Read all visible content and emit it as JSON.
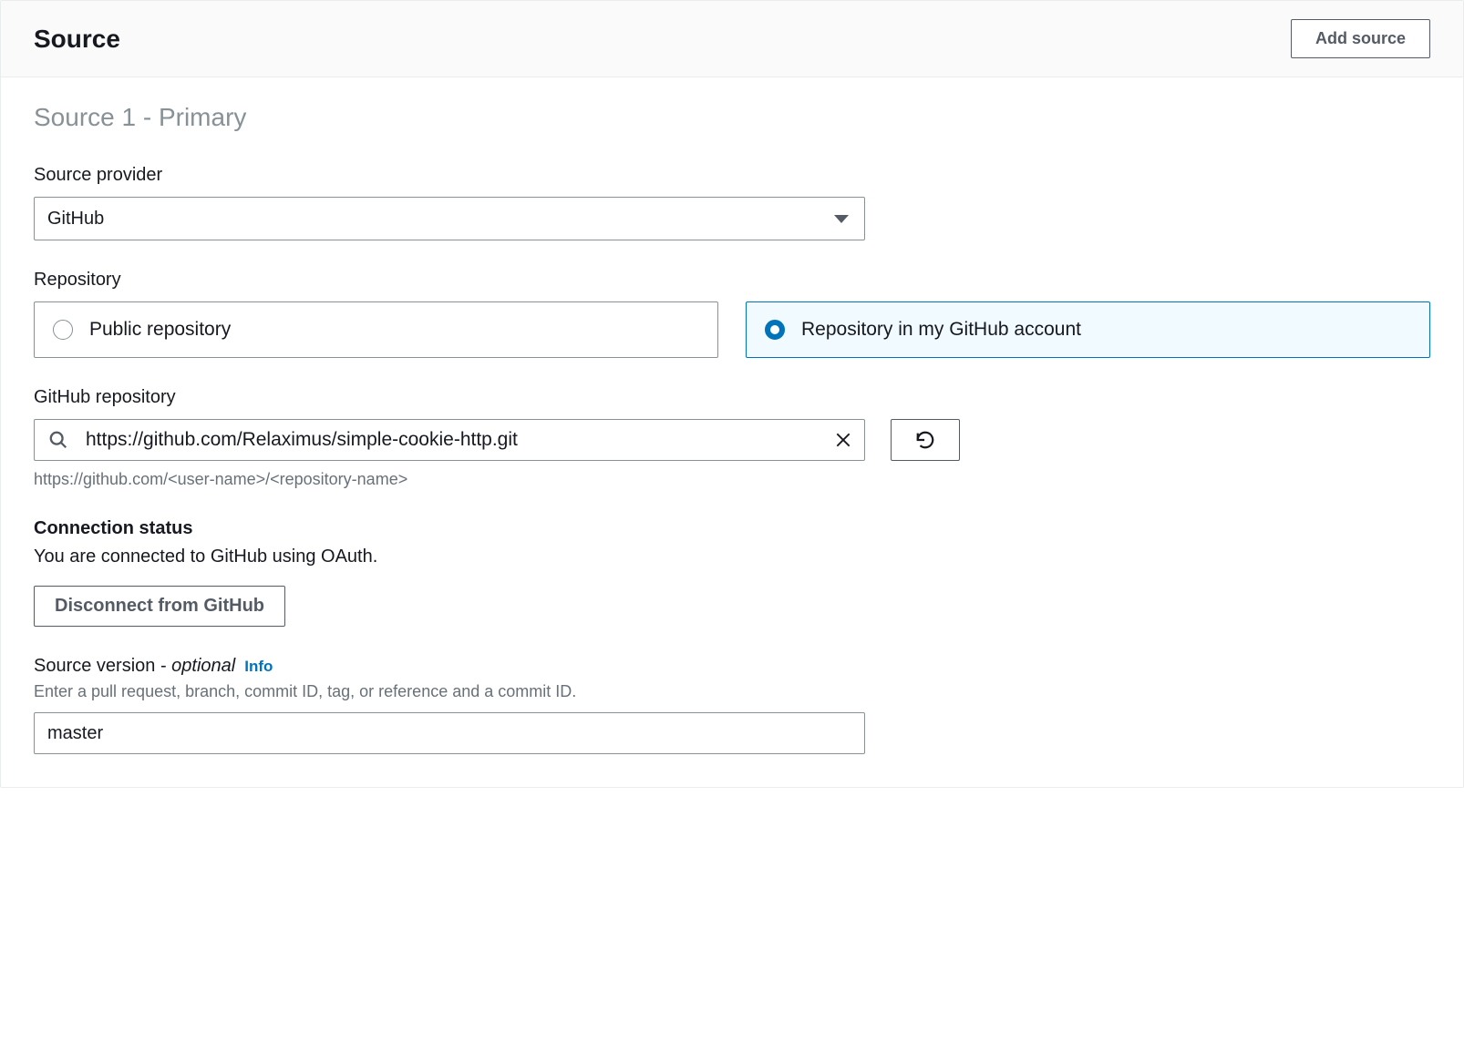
{
  "header": {
    "title": "Source",
    "add_button": "Add source"
  },
  "section": {
    "subheading": "Source 1 - Primary"
  },
  "sourceProvider": {
    "label": "Source provider",
    "value": "GitHub"
  },
  "repository": {
    "label": "Repository",
    "options": [
      {
        "label": "Public repository",
        "selected": false
      },
      {
        "label": "Repository in my GitHub account",
        "selected": true
      }
    ]
  },
  "githubRepo": {
    "label": "GitHub repository",
    "value": "https://github.com/Relaximus/simple-cookie-http.git",
    "helper": "https://github.com/<user-name>/<repository-name>"
  },
  "connection": {
    "heading": "Connection status",
    "text": "You are connected to GitHub using OAuth.",
    "disconnect_label": "Disconnect from GitHub"
  },
  "sourceVersion": {
    "label_main": "Source version - ",
    "label_optional": "optional",
    "info": "Info",
    "hint": "Enter a pull request, branch, commit ID, tag, or reference and a commit ID.",
    "value": "master"
  }
}
